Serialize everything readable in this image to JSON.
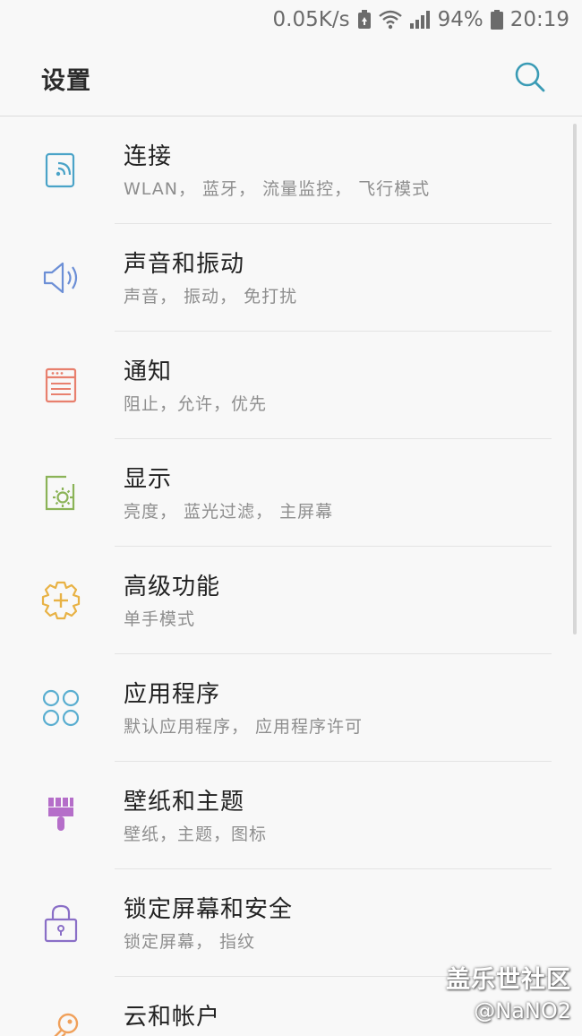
{
  "status_bar": {
    "net_speed": "0.05K/s",
    "battery_percent": "94%",
    "time": "20:19",
    "icons": [
      "data-saver-icon",
      "wifi-icon",
      "signal-icon",
      "battery-icon"
    ]
  },
  "header": {
    "title": "设置",
    "search_icon": "search-icon"
  },
  "colors": {
    "accent": "#3a9bb5",
    "connections": "#4aa3c8",
    "sound": "#6c8fd6",
    "notifications": "#e8806e",
    "display": "#8bb357",
    "advanced": "#e8b245",
    "apps": "#5aaed0",
    "wallpaper": "#b56ec9",
    "lock": "#8a6fc7",
    "cloud": "#f0a05a"
  },
  "items": [
    {
      "title": "连接",
      "subtitle": "WLAN， 蓝牙， 流量监控， 飞行模式",
      "icon": "connections-icon"
    },
    {
      "title": "声音和振动",
      "subtitle": "声音， 振动， 免打扰",
      "icon": "speaker-icon"
    },
    {
      "title": "通知",
      "subtitle": "阻止，允许，优先",
      "icon": "notification-icon"
    },
    {
      "title": "显示",
      "subtitle": "亮度， 蓝光过滤， 主屏幕",
      "icon": "display-icon"
    },
    {
      "title": "高级功能",
      "subtitle": "单手模式",
      "icon": "advanced-features-icon"
    },
    {
      "title": "应用程序",
      "subtitle": "默认应用程序， 应用程序许可",
      "icon": "apps-icon"
    },
    {
      "title": "壁纸和主题",
      "subtitle": "壁纸，主题，图标",
      "icon": "brush-icon"
    },
    {
      "title": "锁定屏幕和安全",
      "subtitle": "锁定屏幕， 指纹",
      "icon": "lock-icon"
    },
    {
      "title": "云和帐户",
      "subtitle": "",
      "icon": "key-icon"
    }
  ],
  "watermark": {
    "line1": "盖乐世社区",
    "line2": "@NaNO2"
  }
}
